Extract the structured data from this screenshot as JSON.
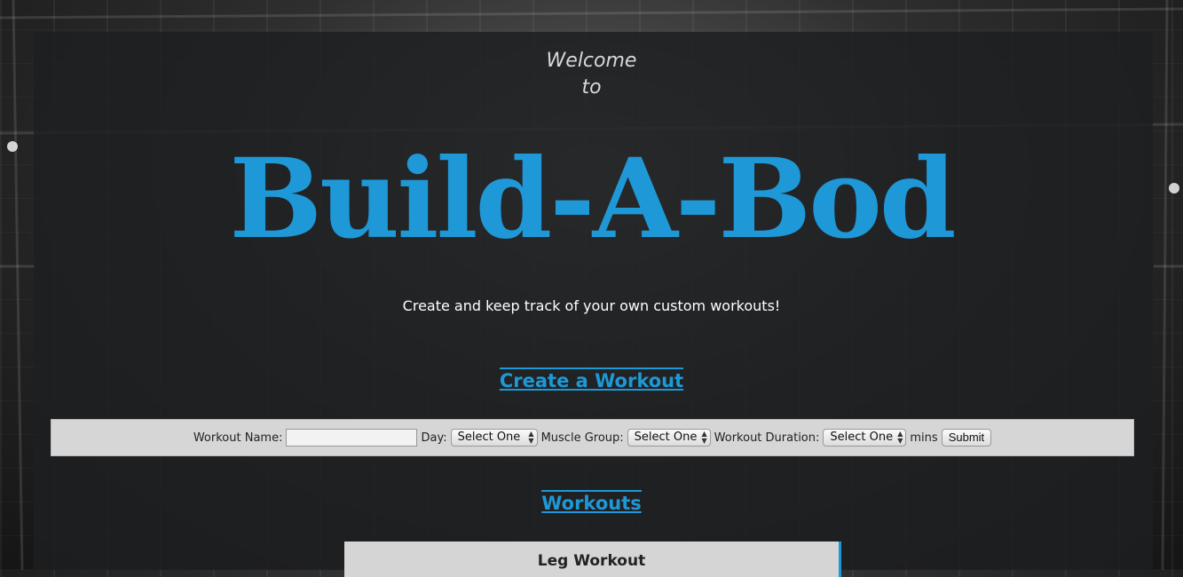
{
  "header": {
    "welcome_line1": "Welcome",
    "welcome_line2": "to",
    "app_title": "Build-A-Bod",
    "tagline": "Create and keep track of your own custom workouts!"
  },
  "create_section": {
    "heading": "Create a Workout",
    "form": {
      "workout_name_label": "Workout Name:",
      "workout_name_value": "",
      "day_label": "Day:",
      "day_value": "Select One",
      "muscle_group_label": "Muscle Group:",
      "muscle_group_value": "Select One",
      "duration_label": "Workout Duration:",
      "duration_value": "Select One",
      "duration_unit": "mins",
      "submit_label": "Submit"
    }
  },
  "workouts_section": {
    "heading": "Workouts",
    "items": [
      {
        "name": "Leg Workout"
      }
    ]
  },
  "colors": {
    "accent": "#1e98d6",
    "panel": "#1e1f21"
  }
}
